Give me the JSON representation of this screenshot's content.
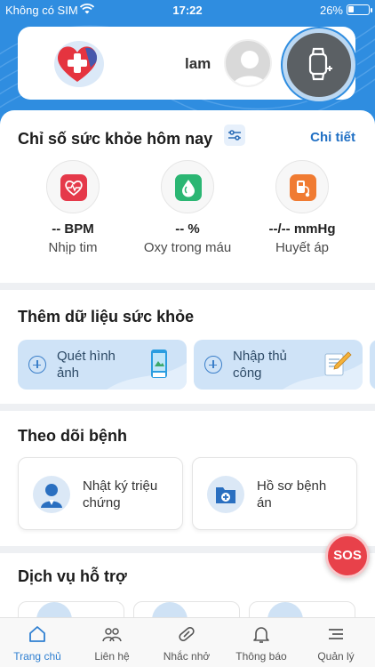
{
  "status_bar": {
    "carrier": "Không có SIM",
    "time": "17:22",
    "battery": "26%"
  },
  "header": {
    "username": "lam"
  },
  "health_today": {
    "title": "Chỉ số sức khỏe hôm nay",
    "detail_link": "Chi tiết",
    "metrics": [
      {
        "value": "-- BPM",
        "label": "Nhịp tim",
        "icon": "heart-rate-icon",
        "color": "#e5394a"
      },
      {
        "value": "-- %",
        "label": "Oxy trong máu",
        "icon": "blood-drop-icon",
        "color": "#2bb673"
      },
      {
        "value": "--/-- mmHg",
        "label": "Huyết áp",
        "icon": "blood-pressure-icon",
        "color": "#f07b32"
      }
    ]
  },
  "add_data": {
    "title": "Thêm dữ liệu sức khỏe",
    "items": [
      {
        "line1": "Quét hình",
        "line2": "ảnh"
      },
      {
        "line1": "Nhập thủ",
        "line2": "công"
      }
    ]
  },
  "follow_disease": {
    "title": "Theo dõi bệnh",
    "items": [
      {
        "line1": "Nhật ký triệu",
        "line2": "chứng"
      },
      {
        "line1": "Hồ sơ bệnh",
        "line2": "án"
      }
    ]
  },
  "support": {
    "title": "Dịch vụ hỗ trợ"
  },
  "sos": {
    "label": "SOS"
  },
  "nav": [
    {
      "label": "Trang chủ",
      "icon": "home-icon"
    },
    {
      "label": "Liên hệ",
      "icon": "contacts-icon"
    },
    {
      "label": "Nhắc nhở",
      "icon": "pill-icon"
    },
    {
      "label": "Thông báo",
      "icon": "bell-icon"
    },
    {
      "label": "Quản lý",
      "icon": "menu-icon"
    }
  ],
  "colors": {
    "primary": "#2f8de0",
    "link": "#1f6fc4",
    "sos": "#e8414a",
    "nav_active": "#2f7fd1"
  }
}
